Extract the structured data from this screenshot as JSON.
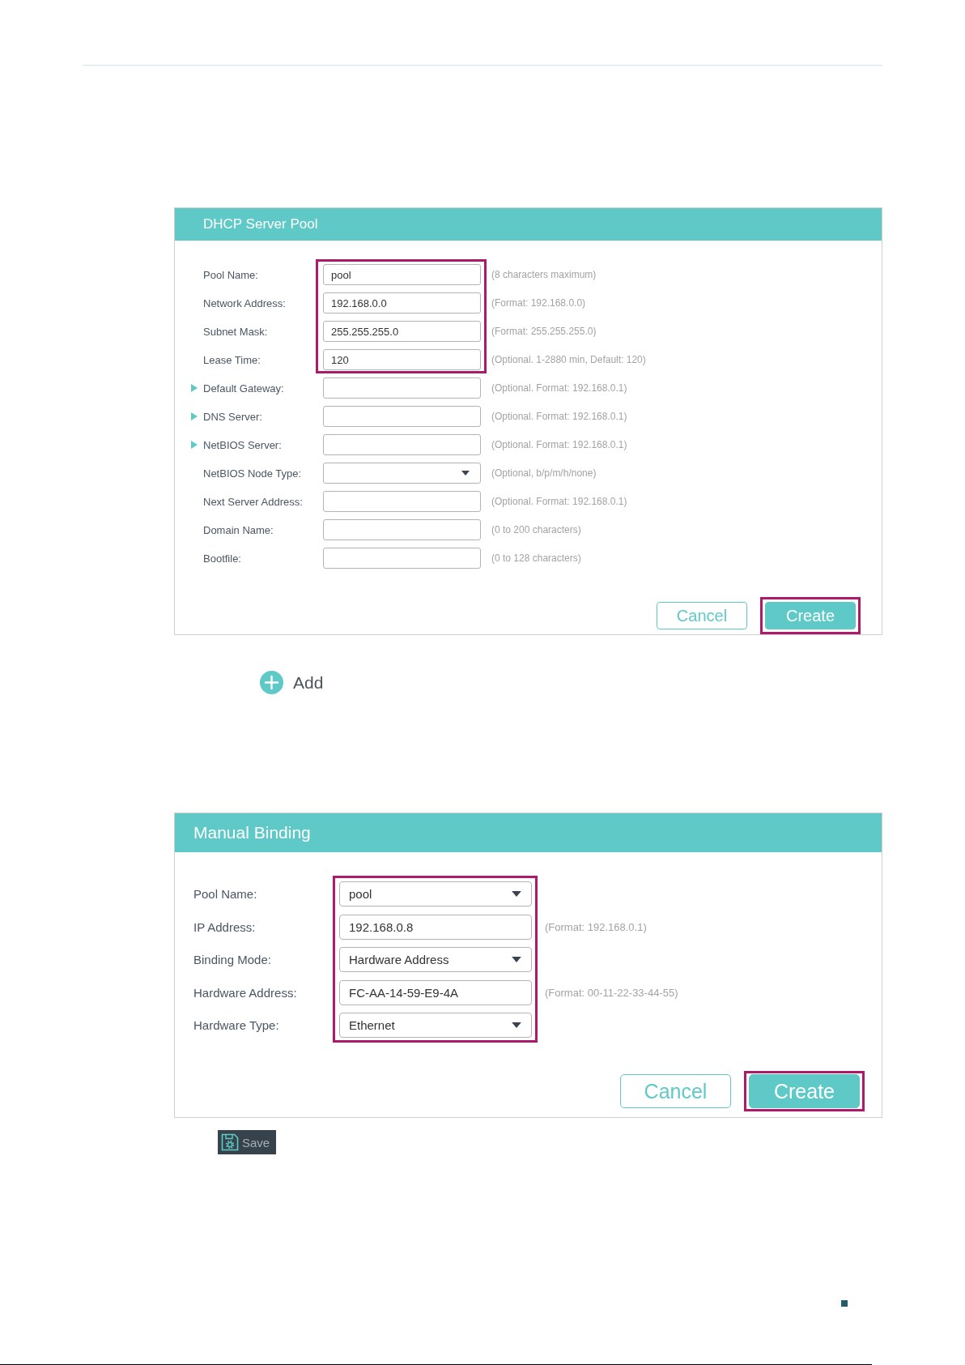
{
  "dhcp_server_pool": {
    "title": "DHCP Server Pool",
    "fields": [
      {
        "label": "Pool Name:",
        "kind": "text",
        "value": "pool",
        "hint": "(8 characters maximum)",
        "expandable": false,
        "highlighted": true
      },
      {
        "label": "Network Address:",
        "kind": "text",
        "value": "192.168.0.0",
        "hint": "(Format: 192.168.0.0)",
        "expandable": false,
        "highlighted": true
      },
      {
        "label": "Subnet Mask:",
        "kind": "text",
        "value": "255.255.255.0",
        "hint": "(Format: 255.255.255.0)",
        "expandable": false,
        "highlighted": true
      },
      {
        "label": "Lease Time:",
        "kind": "text",
        "value": "120",
        "hint": "(Optional. 1-2880 min, Default: 120)",
        "expandable": false,
        "highlighted": true
      },
      {
        "label": "Default Gateway:",
        "kind": "text",
        "hint": "(Optional. Format: 192.168.0.1)",
        "expandable": true,
        "highlighted": false
      },
      {
        "label": "DNS Server:",
        "kind": "text",
        "hint": "(Optional. Format: 192.168.0.1)",
        "expandable": true,
        "highlighted": false
      },
      {
        "label": "NetBIOS Server:",
        "kind": "text",
        "hint": "(Optional. Format: 192.168.0.1)",
        "expandable": true,
        "highlighted": false
      },
      {
        "label": "NetBIOS Node Type:",
        "kind": "select",
        "hint": "(Optional, b/p/m/h/none)",
        "expandable": false,
        "highlighted": false
      },
      {
        "label": "Next Server Address:",
        "kind": "text",
        "hint": "(Optional. Format: 192.168.0.1)",
        "expandable": false,
        "highlighted": false
      },
      {
        "label": "Domain Name:",
        "kind": "text",
        "hint": "(0 to 200 characters)",
        "expandable": false,
        "highlighted": false
      },
      {
        "label": "Bootfile:",
        "kind": "text",
        "hint": "(0 to 128 characters)",
        "expandable": false,
        "highlighted": false
      }
    ],
    "buttons": [
      {
        "label": "Cancel",
        "kind": "cancel",
        "highlighted": false
      },
      {
        "label": "Create",
        "kind": "submit",
        "highlighted": true
      }
    ]
  },
  "add_button": {
    "label": "Add"
  },
  "manual_binding": {
    "title": "Manual Binding",
    "fields": [
      {
        "label": "Pool Name:",
        "kind": "select",
        "value": "pool",
        "highlighted": true
      },
      {
        "label": "IP Address:",
        "kind": "text",
        "value": "192.168.0.8",
        "hint": "(Format: 192.168.0.1)",
        "highlighted": true
      },
      {
        "label": "Binding Mode:",
        "kind": "select",
        "value": "Hardware Address",
        "highlighted": true
      },
      {
        "label": "Hardware Address:",
        "kind": "text",
        "value": "FC-AA-14-59-E9-4A",
        "hint": "(Format: 00-11-22-33-44-55)",
        "highlighted": true
      },
      {
        "label": "Hardware Type:",
        "kind": "select",
        "value": "Ethernet",
        "highlighted": true
      }
    ],
    "buttons": [
      {
        "label": "Cancel",
        "kind": "cancel",
        "highlighted": false
      },
      {
        "label": "Create",
        "kind": "submit",
        "highlighted": true
      }
    ]
  },
  "save_button": {
    "label": "Save"
  }
}
